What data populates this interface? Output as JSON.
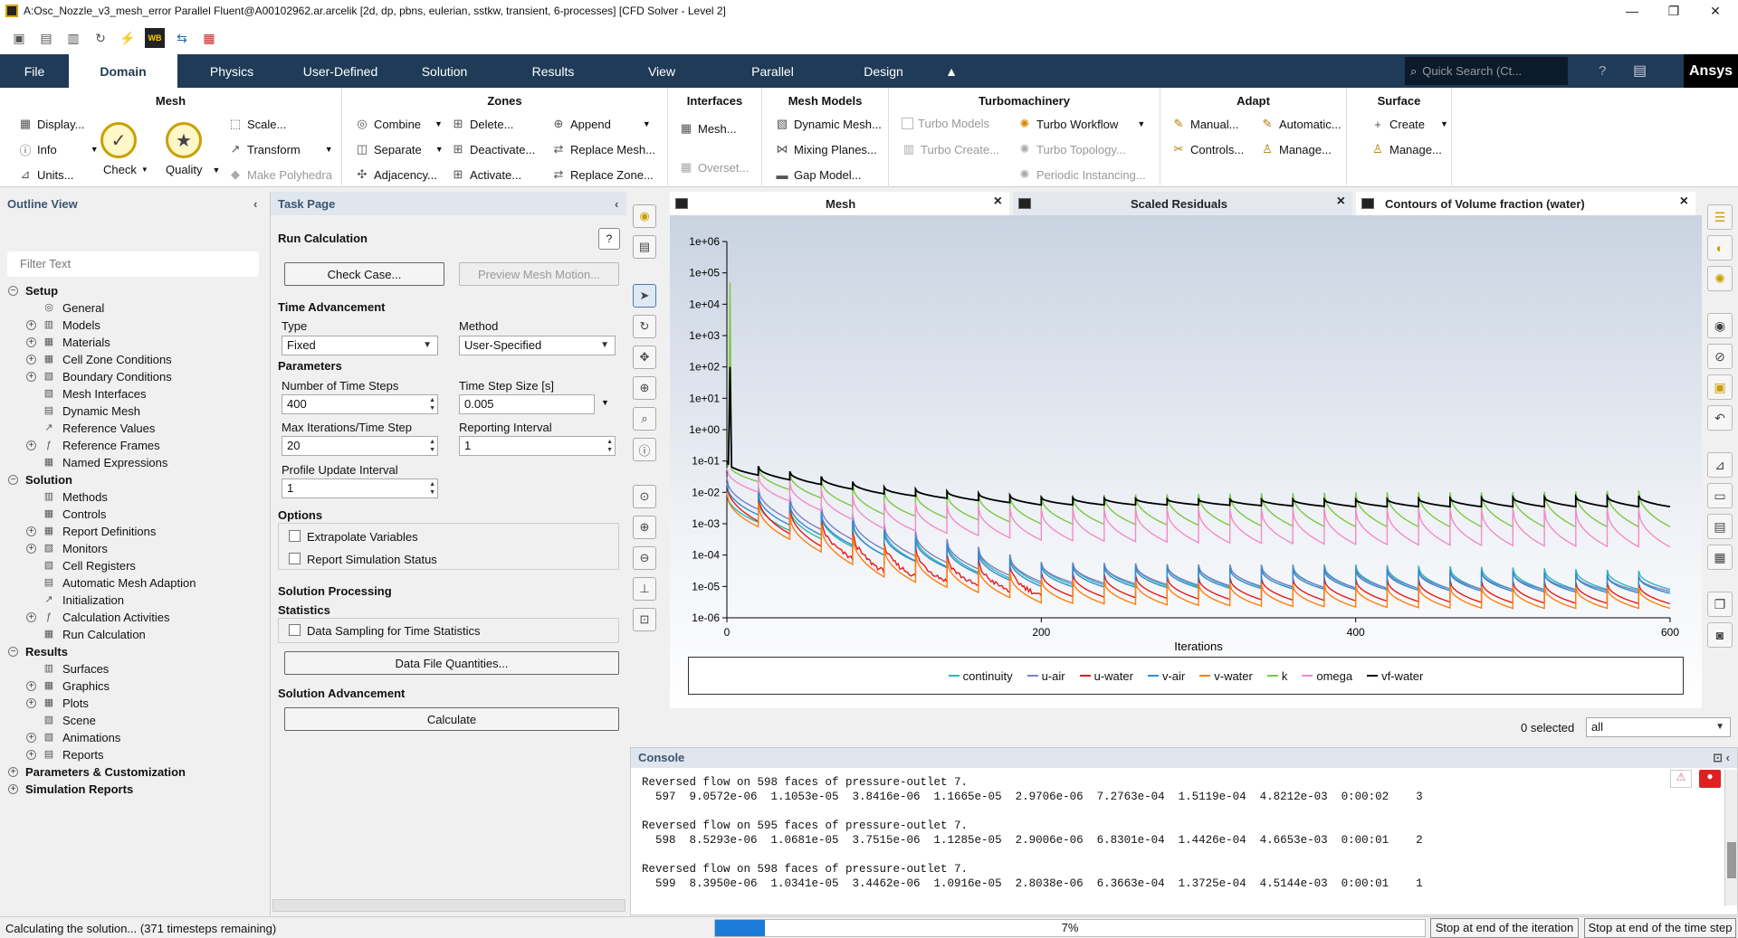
{
  "window": {
    "title": "A:Osc_Nozzle_v3_mesh_error Parallel Fluent@A00102962.ar.arcelik  [2d, dp, pbns, eulerian, sstkw, transient, 6-processes] [CFD Solver - Level 2]",
    "minimize": "—",
    "maximize": "❐",
    "close": "✕"
  },
  "menu": {
    "tabs": [
      "File",
      "Domain",
      "Physics",
      "User-Defined",
      "Solution",
      "Results",
      "View",
      "Parallel",
      "Design"
    ],
    "active": "Domain",
    "search_placeholder": "Quick Search (Ct...",
    "brand": "Ansys"
  },
  "ribbon": {
    "mesh": {
      "title": "Mesh",
      "display": "Display...",
      "info": "Info",
      "units": "Units...",
      "check": "Check",
      "quality": "Quality",
      "scale": "Scale...",
      "transform": "Transform",
      "make_polyhedra": "Make Polyhedra"
    },
    "zones": {
      "title": "Zones",
      "combine": "Combine",
      "separate": "Separate",
      "adjacency": "Adjacency...",
      "delete": "Delete...",
      "deactivate": "Deactivate...",
      "activate": "Activate...",
      "append": "Append",
      "replace_mesh": "Replace Mesh...",
      "replace_zone": "Replace Zone..."
    },
    "interfaces": {
      "title": "Interfaces",
      "mesh": "Mesh...",
      "overset": "Overset..."
    },
    "mesh_models": {
      "title": "Mesh Models",
      "dynamic_mesh": "Dynamic Mesh...",
      "mixing_planes": "Mixing Planes...",
      "gap_model": "Gap Model..."
    },
    "turbo": {
      "title": "Turbomachinery",
      "turbo_models": "Turbo Models",
      "turbo_create": "Turbo Create...",
      "turbo_workflow": "Turbo Workflow",
      "turbo_topology": "Turbo Topology...",
      "periodic": "Periodic Instancing..."
    },
    "adapt": {
      "title": "Adapt",
      "manual": "Manual...",
      "controls": "Controls...",
      "automatic": "Automatic...",
      "manage": "Manage..."
    },
    "surface": {
      "title": "Surface",
      "create": "Create",
      "manage": "Manage..."
    }
  },
  "outline": {
    "header": "Outline View",
    "filter_placeholder": "Filter Text",
    "tree": [
      {
        "label": "Setup",
        "level": 0,
        "bold": true,
        "exp": "−"
      },
      {
        "label": "General",
        "level": 1
      },
      {
        "label": "Models",
        "level": 1,
        "exp": "+"
      },
      {
        "label": "Materials",
        "level": 1,
        "exp": "+"
      },
      {
        "label": "Cell Zone Conditions",
        "level": 1,
        "exp": "+"
      },
      {
        "label": "Boundary Conditions",
        "level": 1,
        "exp": "+"
      },
      {
        "label": "Mesh Interfaces",
        "level": 1
      },
      {
        "label": "Dynamic Mesh",
        "level": 1
      },
      {
        "label": "Reference Values",
        "level": 1
      },
      {
        "label": "Reference Frames",
        "level": 1,
        "exp": "+"
      },
      {
        "label": "Named Expressions",
        "level": 1
      },
      {
        "label": "Solution",
        "level": 0,
        "bold": true,
        "exp": "−"
      },
      {
        "label": "Methods",
        "level": 1
      },
      {
        "label": "Controls",
        "level": 1
      },
      {
        "label": "Report Definitions",
        "level": 1,
        "exp": "+"
      },
      {
        "label": "Monitors",
        "level": 1,
        "exp": "+"
      },
      {
        "label": "Cell Registers",
        "level": 1
      },
      {
        "label": "Automatic Mesh Adaption",
        "level": 1
      },
      {
        "label": "Initialization",
        "level": 1
      },
      {
        "label": "Calculation Activities",
        "level": 1,
        "exp": "+"
      },
      {
        "label": "Run Calculation",
        "level": 1
      },
      {
        "label": "Results",
        "level": 0,
        "bold": true,
        "exp": "−"
      },
      {
        "label": "Surfaces",
        "level": 1
      },
      {
        "label": "Graphics",
        "level": 1,
        "exp": "+"
      },
      {
        "label": "Plots",
        "level": 1,
        "exp": "+"
      },
      {
        "label": "Scene",
        "level": 1
      },
      {
        "label": "Animations",
        "level": 1,
        "exp": "+"
      },
      {
        "label": "Reports",
        "level": 1,
        "exp": "+"
      },
      {
        "label": "Parameters & Customization",
        "level": 0,
        "bold": true,
        "exp": "+"
      },
      {
        "label": "Simulation Reports",
        "level": 0,
        "bold": true,
        "exp": "+"
      }
    ]
  },
  "task": {
    "header": "Task Page",
    "title": "Run Calculation",
    "check_case": "Check Case...",
    "preview_mesh": "Preview Mesh Motion...",
    "time_adv": "Time Advancement",
    "type_label": "Type",
    "type_value": "Fixed",
    "method_label": "Method",
    "method_value": "User-Specified",
    "parameters": "Parameters",
    "nsteps_label": "Number of Time Steps",
    "nsteps_value": "400",
    "tstep_label": "Time Step Size [s]",
    "tstep_value": "0.005",
    "maxit_label": "Max Iterations/Time Step",
    "maxit_value": "20",
    "report_label": "Reporting Interval",
    "report_value": "1",
    "profile_label": "Profile Update Interval",
    "profile_value": "1",
    "options": "Options",
    "extrapolate": "Extrapolate Variables",
    "report_status": "Report Simulation Status",
    "sol_processing": "Solution Processing",
    "statistics": "Statistics",
    "data_sampling": "Data Sampling for Time Statistics",
    "data_file": "Data File Quantities...",
    "sol_adv": "Solution Advancement",
    "calculate": "Calculate"
  },
  "graphics": {
    "tabs": [
      "Mesh",
      "Scaled Residuals",
      "Contours of Volume fraction (water)"
    ],
    "selected_text": "0 selected",
    "selected_value": "all"
  },
  "chart_data": {
    "type": "line",
    "xlabel": "Iterations",
    "x_ticks": [
      "0",
      "200",
      "400",
      "600"
    ],
    "xlim": [
      0,
      600
    ],
    "y_ticks": [
      "1e+06",
      "1e+05",
      "1e+04",
      "1e+03",
      "1e+02",
      "1e+01",
      "1e+00",
      "1e-01",
      "1e-02",
      "1e-03",
      "1e-04",
      "1e-05",
      "1e-06"
    ],
    "ylim": [
      1e-06,
      1000000.0
    ],
    "yscale": "log",
    "legend_position": "bottom",
    "period": 20,
    "series": [
      {
        "name": "continuity",
        "color": "#2ab7b7",
        "peak": [
          0.01,
          0.0008,
          6e-05,
          5e-05,
          5e-05,
          4e-05,
          3e-05
        ],
        "trough": [
          0.002,
          0.0001,
          1.2e-05,
          1e-05,
          9e-06,
          8e-06,
          8e-06
        ]
      },
      {
        "name": "u-air",
        "color": "#7e7ec4",
        "peak": [
          0.03,
          0.001,
          6e-05,
          5e-05,
          4e-05,
          3e-05,
          2e-05
        ],
        "trough": [
          0.006,
          0.00015,
          1.4e-05,
          1.1e-05,
          9e-06,
          8e-06,
          7e-06
        ]
      },
      {
        "name": "u-water",
        "color": "#e41a1c",
        "peak": [
          0.02,
          0.0003,
          3e-05,
          2e-05,
          1.8e-05,
          1.5e-05,
          1.2e-05
        ],
        "trough": [
          0.003,
          3e-05,
          5e-06,
          4e-06,
          3.5e-06,
          3e-06,
          2.8e-06
        ]
      },
      {
        "name": "v-air",
        "color": "#2f8bd0",
        "peak": [
          0.02,
          0.0006,
          5e-05,
          4e-05,
          3.5e-05,
          3e-05,
          2e-05
        ],
        "trough": [
          0.004,
          0.0001,
          1e-05,
          9e-06,
          8e-06,
          7e-06,
          6e-06
        ]
      },
      {
        "name": "v-water",
        "color": "#ff7f0e",
        "peak": [
          0.01,
          0.0002,
          1.8e-05,
          1.3e-05,
          1.1e-05,
          1e-05,
          9e-06
        ],
        "trough": [
          0.002,
          2e-05,
          3e-06,
          2.5e-06,
          2.2e-06,
          2e-06,
          2e-06
        ]
      },
      {
        "name": "k",
        "color": "#7ac943",
        "peak": [
          0.1,
          0.012,
          0.008,
          0.009,
          0.01,
          0.01,
          0.012
        ],
        "trough": [
          0.04,
          0.002,
          0.001,
          0.0009,
          0.0008,
          0.0008,
          0.0008
        ]
      },
      {
        "name": "omega",
        "color": "#f48bc8",
        "peak": [
          0.06,
          0.005,
          0.003,
          0.003,
          0.003,
          0.003,
          0.003
        ],
        "trough": [
          0.02,
          0.0007,
          0.0003,
          0.00025,
          0.00022,
          0.0002,
          0.00018
        ]
      },
      {
        "name": "vf-water",
        "color": "#000000",
        "peak": [
          0.1,
          0.015,
          0.007,
          0.006,
          0.006,
          0.007,
          0.008
        ],
        "trough": [
          0.05,
          0.009,
          0.004,
          0.004,
          0.0035,
          0.0035,
          0.0035
        ]
      }
    ],
    "spike": {
      "x": 2,
      "values": {
        "k": 50000.0,
        "vf-water": 100.0
      }
    }
  },
  "console": {
    "header": "Console",
    "lines": [
      "Reversed flow on 598 faces of pressure-outlet 7.",
      "  597  9.0572e-06  1.1053e-05  3.8416e-06  1.1665e-05  2.9706e-06  7.2763e-04  1.5119e-04  4.8212e-03  0:00:02    3",
      "",
      "Reversed flow on 595 faces of pressure-outlet 7.",
      "  598  8.5293e-06  1.0681e-05  3.7515e-06  1.1285e-05  2.9006e-06  6.8301e-04  1.4426e-04  4.6653e-03  0:00:01    2",
      "",
      "Reversed flow on 598 faces of pressure-outlet 7.",
      "  599  8.3950e-06  1.0341e-05  3.4462e-06  1.0916e-05  2.8038e-06  6.3663e-04  1.3725e-04  4.5144e-03  0:00:01    1"
    ]
  },
  "status": {
    "text": "Calculating the solution... (371 timesteps remaining)",
    "progress_percent": 7,
    "progress_label": "7%",
    "stop_iter": "Stop at end of the iteration",
    "stop_step": "Stop at end of the time step"
  }
}
